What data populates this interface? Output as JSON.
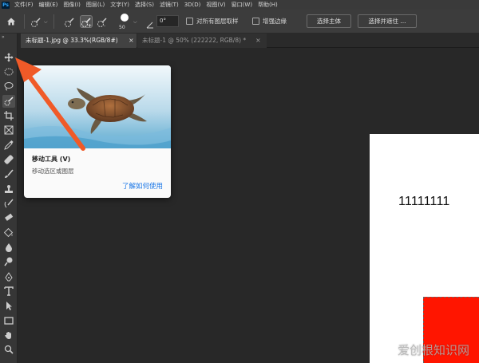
{
  "app": {
    "logo": "Ps"
  },
  "menu": [
    "文件(F)",
    "编辑(E)",
    "图像(I)",
    "图层(L)",
    "文字(Y)",
    "选择(S)",
    "滤镜(T)",
    "3D(D)",
    "视图(V)",
    "窗口(W)",
    "帮助(H)"
  ],
  "options": {
    "brush_size": "50",
    "angle_value": "0°",
    "sample_all_layers_label": "对所有图层取样",
    "enhance_edge_label": "增强边缘",
    "select_subject_label": "选择主体",
    "select_and_mask_label": "选择并遮住 ..."
  },
  "tabs": [
    {
      "label": "未标题-1.jpg @ 33.3%(RGB/8#)",
      "close": "×"
    },
    {
      "label": "未标题-1 @ 50% (222222, RGB/8) *",
      "close": "×"
    }
  ],
  "toolbar": {
    "collapse": "»",
    "tools": [
      "move-tool",
      "elliptical-marquee-tool",
      "lasso-tool",
      "quick-selection-tool",
      "crop-tool",
      "frame-tool",
      "eyedropper-tool",
      "healing-brush-tool",
      "brush-tool",
      "clone-stamp-tool",
      "history-brush-tool",
      "eraser-tool",
      "paint-bucket-tool",
      "blur-tool",
      "dodge-tool",
      "pen-tool",
      "type-tool",
      "path-selection-tool",
      "rectangle-tool",
      "hand-tool",
      "zoom-tool"
    ]
  },
  "tooltip": {
    "title": "移动工具 (V)",
    "description": "移动选区或图层",
    "link": "了解如何使用"
  },
  "canvas": {
    "text": "11111111"
  },
  "watermark": "爱创根知识网",
  "colors": {
    "accent_link": "#1473e6",
    "arrow": "#f05a28",
    "red_shape": "#ff1500"
  }
}
